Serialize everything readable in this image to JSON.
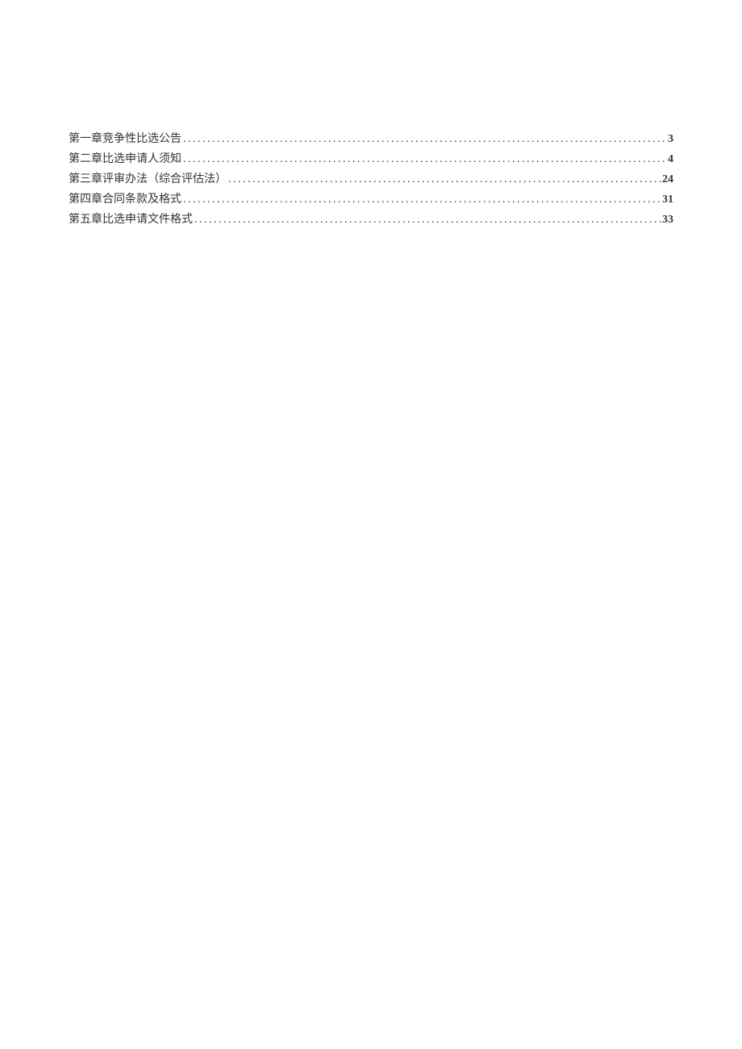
{
  "toc": {
    "entries": [
      {
        "title": "第一章竞争性比选公告",
        "page": "3"
      },
      {
        "title": "第二章比选申请人须知",
        "page": "4"
      },
      {
        "title": "第三章评审办法（综合评估法）",
        "page": "24"
      },
      {
        "title": "第四章合同条款及格式",
        "page": "31"
      },
      {
        "title": "第五章比选申请文件格式",
        "page": "33"
      }
    ]
  }
}
